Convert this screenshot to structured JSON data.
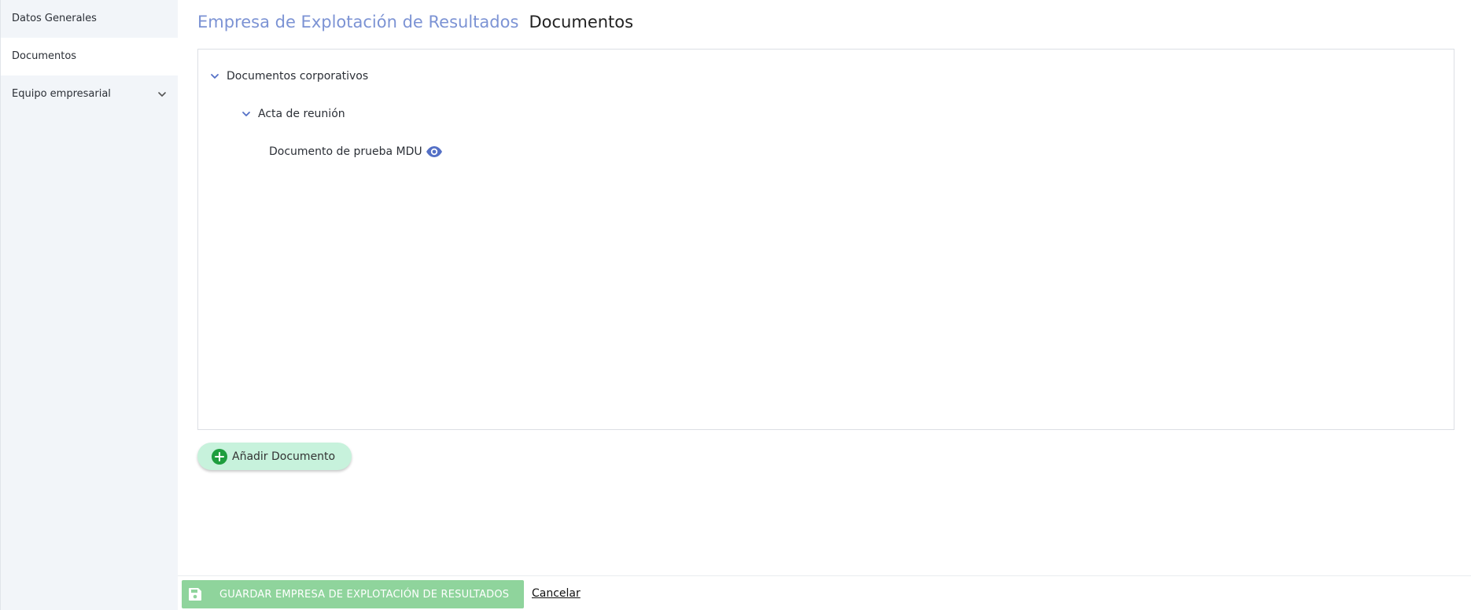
{
  "sidebar": {
    "items": [
      {
        "label": "Datos Generales"
      },
      {
        "label": "Documentos"
      },
      {
        "label": "Equipo empresarial"
      }
    ]
  },
  "header": {
    "company": "Empresa de Explotación de Resultados",
    "section": "Documentos"
  },
  "tree": {
    "folder": "Documentos corporativos",
    "subfolder": "Acta de reunión",
    "document": "Documento de prueba MDU"
  },
  "actions": {
    "add_label": "Añadir Documento",
    "save_label": "GUARDAR EMPRESA DE EXPLOTACIÓN DE RESULTADOS",
    "cancel_label": "Cancelar"
  },
  "colors": {
    "accent": "#5470c6",
    "title_company": "#7c93d4",
    "add_button_bg": "#c7f2dc",
    "add_icon": "#1e9e3e",
    "save_button_bg": "#8fd49c",
    "sidebar_bg": "#f2f5f9"
  },
  "icons": {
    "expand": "chevron-down-icon",
    "view": "eye-icon",
    "add": "plus-circle-icon",
    "save": "floppy-disk-icon"
  }
}
